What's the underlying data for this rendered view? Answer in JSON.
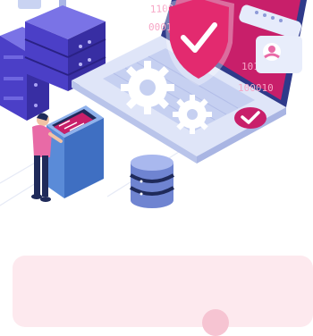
{
  "illustration": {
    "binary_rows": [
      "1100",
      "101001",
      "100010",
      "0001"
    ],
    "colors": {
      "server_blue": "#4b3fc7",
      "server_top": "#7a73e6",
      "laptop_base": "#d6def5",
      "laptop_screen_bg": "#c81f6a",
      "shield_pink": "#e32a6f",
      "gear": "#ffffff",
      "person_shirt": "#e86aa6",
      "person_pants": "#1f2a5a",
      "kiosk": "#5a8bd8",
      "database": "#7f93d8",
      "card_bg": "#fde9ee"
    },
    "icons": [
      "shield-check-icon",
      "gear-icon",
      "user-profile-icon",
      "checkmark-badge-icon",
      "database-icon",
      "server-rack-icon"
    ]
  }
}
